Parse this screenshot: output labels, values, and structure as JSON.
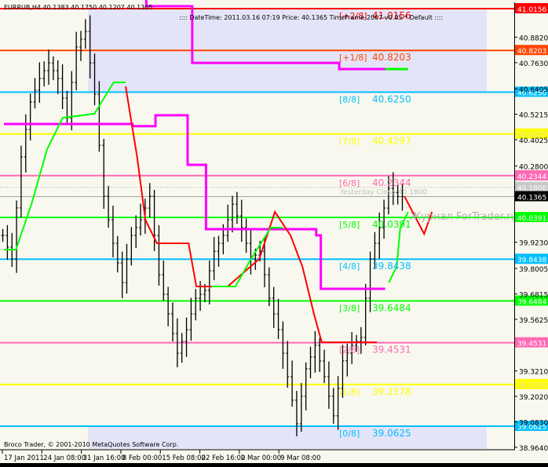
{
  "header": {
    "symbol_info": "EURRUB,H4  40.1383 40.1750 40.1207 40.1365",
    "info_line": ":::: DateTime: 2011.03.16 07:19   Price: 40.1365   TimeFrame-2007-v0.05    *  Default  ::::"
  },
  "footer": {
    "copyright": "Broco Trader, © 2001-2010 MetaQuotes Software Corp."
  },
  "watermark": "Журнал ForTrader.ru",
  "colors": {
    "background": "#f8f8ee",
    "shade": "#e4e4f8",
    "bars": "#000000",
    "magenta": "#ff00ff",
    "red": "#ff0000",
    "green": "#00ff00"
  },
  "chart_data": {
    "type": "candlestick",
    "title": "EURRUB,H4",
    "ylim": [
      38.93,
      41.06
    ],
    "x_unit": "bar index",
    "x_ticks": [
      {
        "idx": 0,
        "label": "17 Jan 2011"
      },
      {
        "idx": 8.6,
        "label": "24 Jan 08:00"
      },
      {
        "idx": 17.2,
        "label": "31 Jan 16:00"
      },
      {
        "idx": 25.8,
        "label": "8 Feb 00:00"
      },
      {
        "idx": 34.4,
        "label": "15 Feb 08:00"
      },
      {
        "idx": 43,
        "label": "22 Feb 16:00"
      },
      {
        "idx": 51.6,
        "label": "2 Mar 00:00"
      },
      {
        "idx": 60.2,
        "label": "9 Mar 08:00"
      }
    ],
    "y_ticks": [
      "40.8820",
      "40.7630",
      "40.6405",
      "40.5215",
      "40.4025",
      "40.2800",
      "39.9230",
      "39.8005",
      "39.6815",
      "39.5625",
      "39.3210",
      "39.2020",
      "39.0830",
      "38.9640"
    ],
    "closes": [
      39.955,
      39.845,
      40.322,
      40.579,
      40.689,
      40.762,
      40.689,
      40.505,
      40.836,
      40.909,
      40.615,
      40.138,
      39.918,
      39.734,
      39.955,
      40.028,
      40.138,
      39.771,
      39.588,
      39.404,
      39.514,
      39.661,
      39.698,
      39.881,
      39.955,
      40.101,
      39.991,
      39.845,
      39.881,
      39.661,
      39.514,
      39.294,
      39.074,
      39.331,
      39.441,
      39.294,
      39.111,
      39.368,
      39.441,
      39.478,
      39.845,
      39.991,
      40.175,
      40.1365
    ],
    "levels": [
      {
        "label": "[+2/8]",
        "value": "41.0156",
        "color": "#ff0000"
      },
      {
        "label": "[+1/8]",
        "value": "40.8203",
        "color": "#ff4500"
      },
      {
        "label": "[8/8]",
        "value": "40.6250",
        "color": "#00bfff"
      },
      {
        "label": "[7/8]",
        "value": "40.4297",
        "color": "#ffff00"
      },
      {
        "label": "[6/8]",
        "value": "40.2344",
        "color": "#ff69b4"
      },
      {
        "label": "[5/8]",
        "value": "40.0391",
        "color": "#00ff00"
      },
      {
        "label": "[4/8]",
        "value": "39.8438",
        "color": "#00bfff"
      },
      {
        "label": "[3/8]",
        "value": "39.6484",
        "color": "#00ff00"
      },
      {
        "label": "[2/8]",
        "value": "39.4531",
        "color": "#ff69b4"
      },
      {
        "label": "[1/8]",
        "value": "39.2578",
        "color": "#ffff00"
      },
      {
        "label": "[0/8]",
        "value": "39.0625",
        "color": "#00bfff"
      }
    ],
    "yesterday_close": {
      "label": "Yesterday Close",
      "value": "40.1800"
    },
    "current_price": "40.1365",
    "magenta_line": [
      [
        0,
        40.476
      ],
      [
        28,
        40.476
      ],
      [
        28,
        40.466
      ],
      [
        33,
        40.466
      ],
      [
        33,
        40.517
      ],
      [
        40,
        40.517
      ],
      [
        40,
        40.285
      ],
      [
        44,
        40.285
      ],
      [
        44,
        39.984
      ],
      [
        68,
        39.984
      ],
      [
        68,
        39.955
      ],
      [
        69,
        39.955
      ],
      [
        69,
        39.705
      ],
      [
        83,
        39.705
      ]
    ],
    "magenta_projection": [
      [
        31,
        41.06
      ],
      [
        31,
        41.027
      ],
      [
        41,
        41.027
      ],
      [
        41,
        40.762
      ],
      [
        73,
        40.762
      ],
      [
        73,
        40.733
      ],
      [
        83,
        40.733
      ]
    ],
    "green_projection": [
      [
        83,
        40.733
      ],
      [
        88,
        40.733
      ]
    ],
    "red_line": [
      [
        26.5,
        40.652
      ],
      [
        29,
        40.322
      ],
      [
        30.8,
        40.028
      ],
      [
        33.3,
        39.918
      ],
      [
        40.2,
        39.918
      ],
      [
        41.9,
        39.716
      ],
      [
        48.7,
        39.716
      ],
      [
        55.6,
        39.845
      ],
      [
        59,
        40.065
      ],
      [
        62.4,
        39.955
      ],
      [
        65,
        39.808
      ],
      [
        67.5,
        39.588
      ],
      [
        69.2,
        39.455
      ],
      [
        81.2,
        39.455
      ]
    ],
    "red_forecast": [
      [
        87.2,
        40.138
      ],
      [
        91.5,
        39.962
      ],
      [
        93.2,
        40.065
      ]
    ],
    "green_line_1": [
      [
        0,
        39.888
      ],
      [
        2.6,
        39.888
      ],
      [
        6,
        40.101
      ],
      [
        9.4,
        40.358
      ],
      [
        12.8,
        40.505
      ],
      [
        19.7,
        40.524
      ],
      [
        23.9,
        40.671
      ],
      [
        26.5,
        40.671
      ]
    ],
    "green_line_2": [
      [
        45.3,
        39.716
      ],
      [
        50.4,
        39.716
      ],
      [
        53.8,
        39.845
      ],
      [
        58.1,
        39.991
      ],
      [
        60.7,
        39.991
      ]
    ],
    "green_line_3": [
      [
        83.8,
        39.734
      ],
      [
        85.5,
        39.808
      ],
      [
        86.3,
        39.991
      ],
      [
        88,
        40.065
      ]
    ]
  }
}
